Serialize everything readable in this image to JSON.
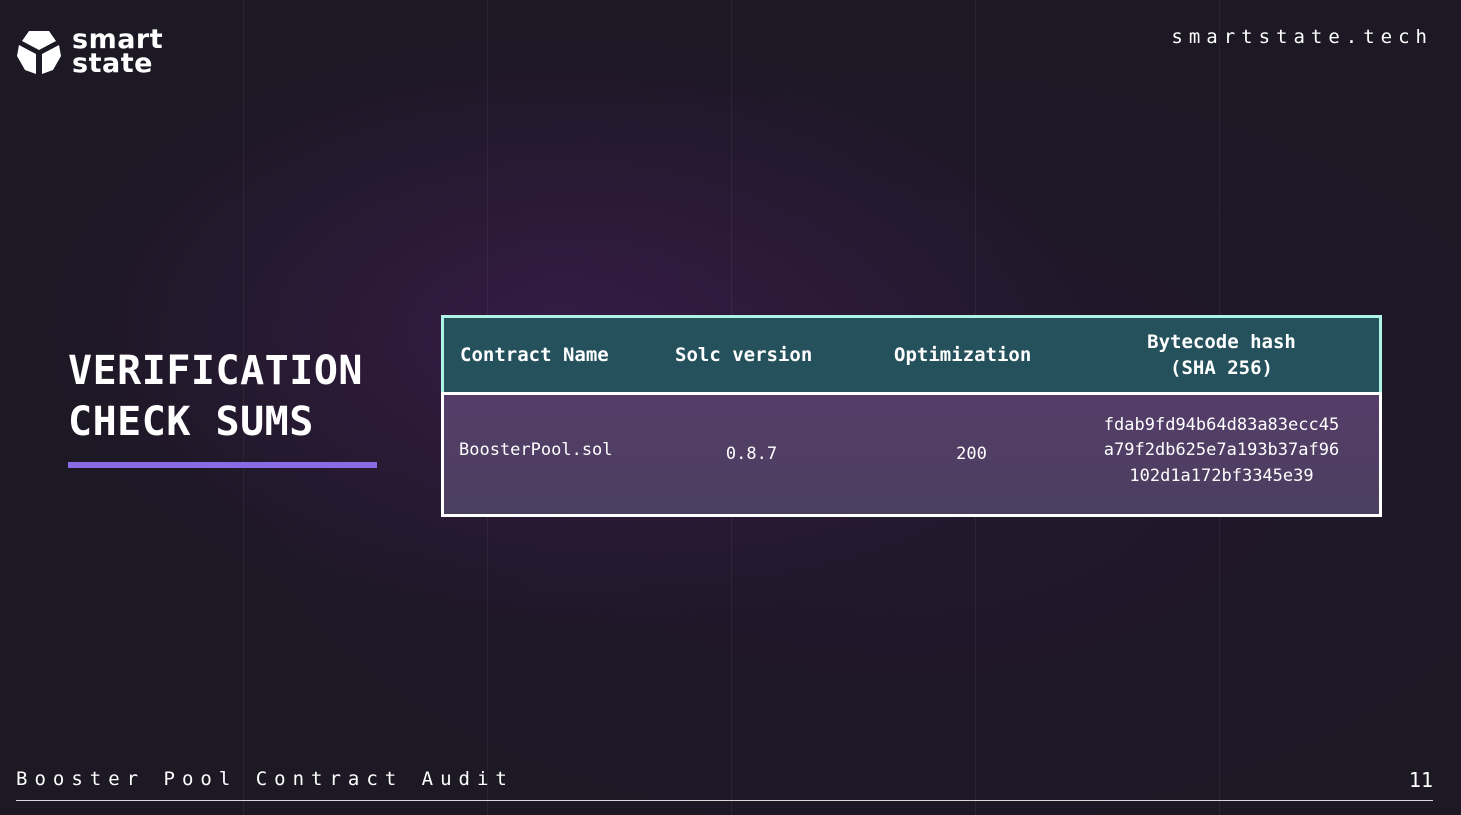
{
  "header": {
    "logo_line1": "smart",
    "logo_line2": "state",
    "site_url": "smartstate.tech"
  },
  "section": {
    "title_line1": "VERIFICATION",
    "title_line2": "CHECK SUMS"
  },
  "table": {
    "headers": {
      "contract_name": "Contract Name",
      "solc_version": "Solc version",
      "optimization": "Optimization",
      "bytecode_hash_line1": "Bytecode hash",
      "bytecode_hash_line2": "(SHA 256)"
    },
    "rows": [
      {
        "contract_name": "BoosterPool.sol",
        "solc_version": "0.8.7",
        "optimization": "200",
        "hash_line1": "fdab9fd94b64d83a83ecc45",
        "hash_line2": "a79f2db625e7a193b37af96",
        "hash_line3": "102d1a172bf3345e39"
      }
    ]
  },
  "footer": {
    "document_title": "Booster Pool Contract Audit",
    "page_number": "11"
  },
  "colors": {
    "background": "#1c1824",
    "accent_purple": "#8a6be6",
    "header_fill": "#24515c",
    "header_border": "#aef3e6",
    "row_fill": "#503f66"
  }
}
